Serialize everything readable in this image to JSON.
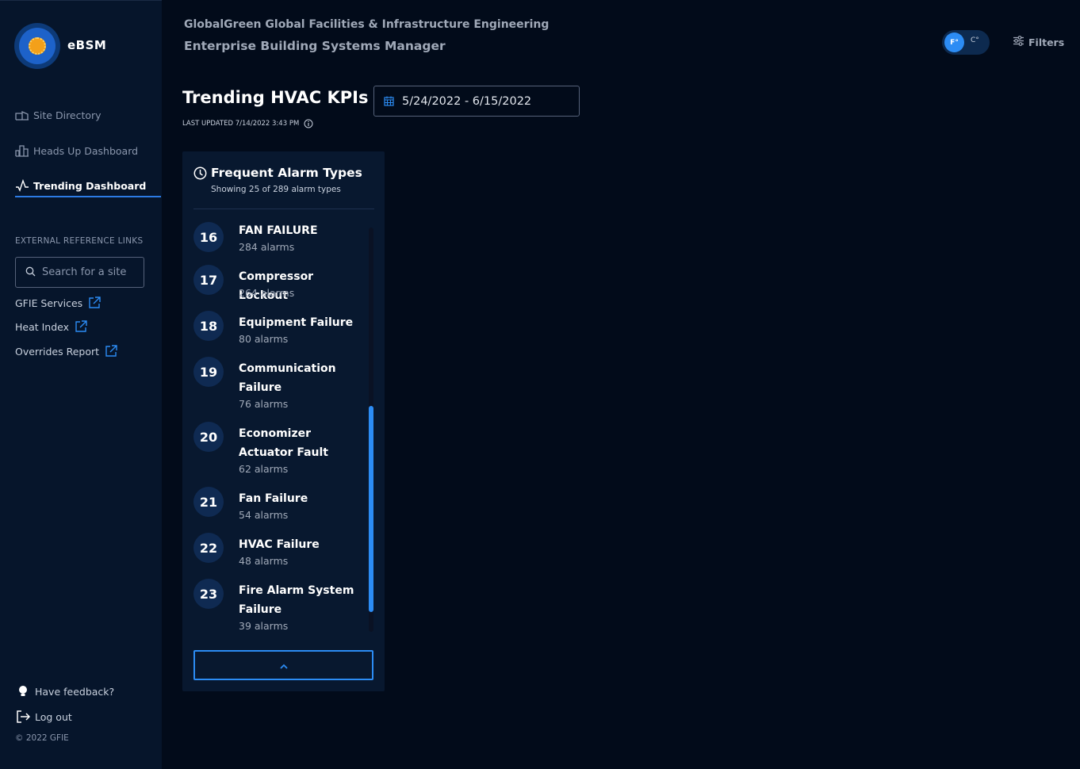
{
  "brand": {
    "name": "eBSM"
  },
  "header": {
    "org_title": "GlobalGreen Global Facilities & Infrastructure Engineering",
    "app_title": "Enterprise Building Systems Manager",
    "unit_f": "F°",
    "unit_c": "C°",
    "filters_label": "Filters"
  },
  "sidebar": {
    "nav": [
      {
        "label": "Site Directory",
        "icon": "building-icon"
      },
      {
        "label": "Heads Up Dashboard",
        "icon": "bar-chart-icon"
      },
      {
        "label": "Trending Dashboard",
        "icon": "pulse-icon",
        "active": true
      }
    ],
    "section_label": "EXTERNAL REFERENCE LINKS",
    "search_placeholder": "Search for a site",
    "links": [
      {
        "label": "GFIE Services"
      },
      {
        "label": "Heat Index"
      },
      {
        "label": "Overrides Report"
      }
    ],
    "feedback_label": "Have feedback?",
    "logout_label": "Log out",
    "copyright": "© 2022 GFIE"
  },
  "main": {
    "page_title": "Trending HVAC KPIs",
    "last_updated": "LAST UPDATED 7/14/2022 3:43 PM",
    "date_range": "5/24/2022 - 6/15/2022"
  },
  "card": {
    "title": "Frequent Alarm Types",
    "subtitle": "Showing 25 of 289 alarm types",
    "alarms": [
      {
        "rank": "16",
        "name": "FAN FAILURE",
        "count": "284 alarms"
      },
      {
        "rank": "17",
        "name": "Compressor Lockout",
        "count": "264 alarms"
      },
      {
        "rank": "18",
        "name": "Equipment Failure",
        "count": "80 alarms"
      },
      {
        "rank": "19",
        "name": "Communication Failure",
        "count": "76 alarms"
      },
      {
        "rank": "20",
        "name": "Economizer Actuator Fault",
        "count": "62 alarms"
      },
      {
        "rank": "21",
        "name": "Fan Failure",
        "count": "54 alarms"
      },
      {
        "rank": "22",
        "name": "HVAC Failure",
        "count": "48 alarms"
      },
      {
        "rank": "23",
        "name": "Fire Alarm System Failure",
        "count": "39 alarms"
      }
    ]
  },
  "colors": {
    "accent": "#2c8cf4",
    "background": "#020b1a",
    "sidebar": "#06152b",
    "card": "#08182f"
  }
}
